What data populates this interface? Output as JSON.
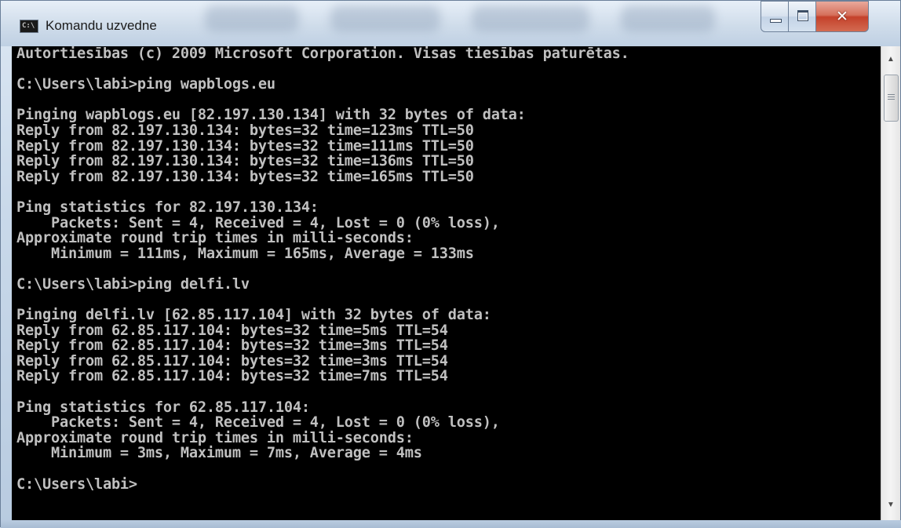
{
  "window": {
    "title": "Komandu uzvedne",
    "icon_label": "C:\\",
    "controls": [
      "minimize-icon",
      "maximize-icon",
      "close-icon"
    ]
  },
  "console": {
    "lines": [
      "Autortiesības (c) 2009 Microsoft Corporation. Visas tiesības paturētas.",
      "",
      "C:\\Users\\labi>ping wapblogs.eu",
      "",
      "Pinging wapblogs.eu [82.197.130.134] with 32 bytes of data:",
      "Reply from 82.197.130.134: bytes=32 time=123ms TTL=50",
      "Reply from 82.197.130.134: bytes=32 time=111ms TTL=50",
      "Reply from 82.197.130.134: bytes=32 time=136ms TTL=50",
      "Reply from 82.197.130.134: bytes=32 time=165ms TTL=50",
      "",
      "Ping statistics for 82.197.130.134:",
      "    Packets: Sent = 4, Received = 4, Lost = 0 (0% loss),",
      "Approximate round trip times in milli-seconds:",
      "    Minimum = 111ms, Maximum = 165ms, Average = 133ms",
      "",
      "C:\\Users\\labi>ping delfi.lv",
      "",
      "Pinging delfi.lv [62.85.117.104] with 32 bytes of data:",
      "Reply from 62.85.117.104: bytes=32 time=5ms TTL=54",
      "Reply from 62.85.117.104: bytes=32 time=3ms TTL=54",
      "Reply from 62.85.117.104: bytes=32 time=3ms TTL=54",
      "Reply from 62.85.117.104: bytes=32 time=7ms TTL=54",
      "",
      "Ping statistics for 62.85.117.104:",
      "    Packets: Sent = 4, Received = 4, Lost = 0 (0% loss),",
      "Approximate round trip times in milli-seconds:",
      "    Minimum = 3ms, Maximum = 7ms, Average = 4ms",
      "",
      "C:\\Users\\labi>"
    ]
  },
  "colors": {
    "console_background": "#000000",
    "console_text": "#c0c0c0",
    "close_button": "#c4412b"
  }
}
